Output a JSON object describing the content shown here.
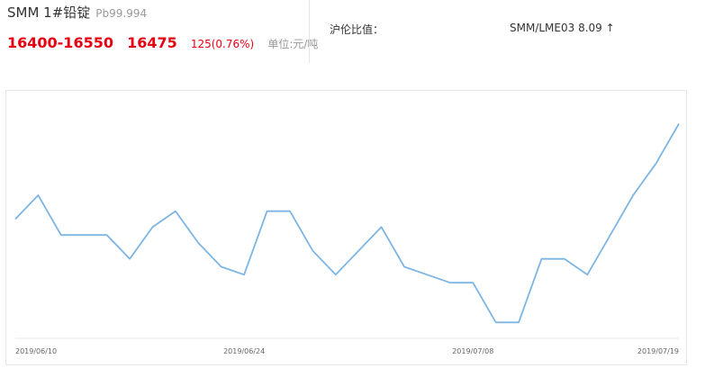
{
  "header": {
    "title": "SMM 1#铅锭",
    "grade": "Pb99.994",
    "price_range": "16400-16550",
    "price_avg": "16475",
    "price_change": "125(0.76%)",
    "unit": "单位:元/吨",
    "ratio_label": "沪伦比值：",
    "ratio_value": "SMM/LME03 8.09 ↑"
  },
  "colors": {
    "price": "#e60012",
    "line": "#7db5e3",
    "axis": "#e8e8e8"
  },
  "chart_data": {
    "type": "line",
    "x": [
      "2019/06/10",
      "2019/06/11",
      "2019/06/12",
      "2019/06/13",
      "2019/06/14",
      "2019/06/17",
      "2019/06/18",
      "2019/06/19",
      "2019/06/20",
      "2019/06/21",
      "2019/06/24",
      "2019/06/25",
      "2019/06/26",
      "2019/06/27",
      "2019/06/28",
      "2019/07/01",
      "2019/07/02",
      "2019/07/03",
      "2019/07/04",
      "2019/07/05",
      "2019/07/08",
      "2019/07/09",
      "2019/07/10",
      "2019/07/11",
      "2019/07/12",
      "2019/07/15",
      "2019/07/16",
      "2019/07/17",
      "2019/07/18",
      "2019/07/19"
    ],
    "x_ticks": [
      "2019/06/10",
      "2019/06/24",
      "2019/07/08",
      "2019/07/19"
    ],
    "series": [
      {
        "values": [
          16150,
          16225,
          16100,
          16100,
          16100,
          16025,
          16125,
          16175,
          16075,
          16000,
          15975,
          16175,
          16175,
          16050,
          15975,
          16050,
          16125,
          16000,
          15975,
          15950,
          15950,
          15825,
          15825,
          16025,
          16025,
          15975,
          16100,
          16225,
          16325,
          16450
        ]
      }
    ],
    "ylim": [
      15775,
      16525
    ],
    "grid": false,
    "legend": "none"
  }
}
